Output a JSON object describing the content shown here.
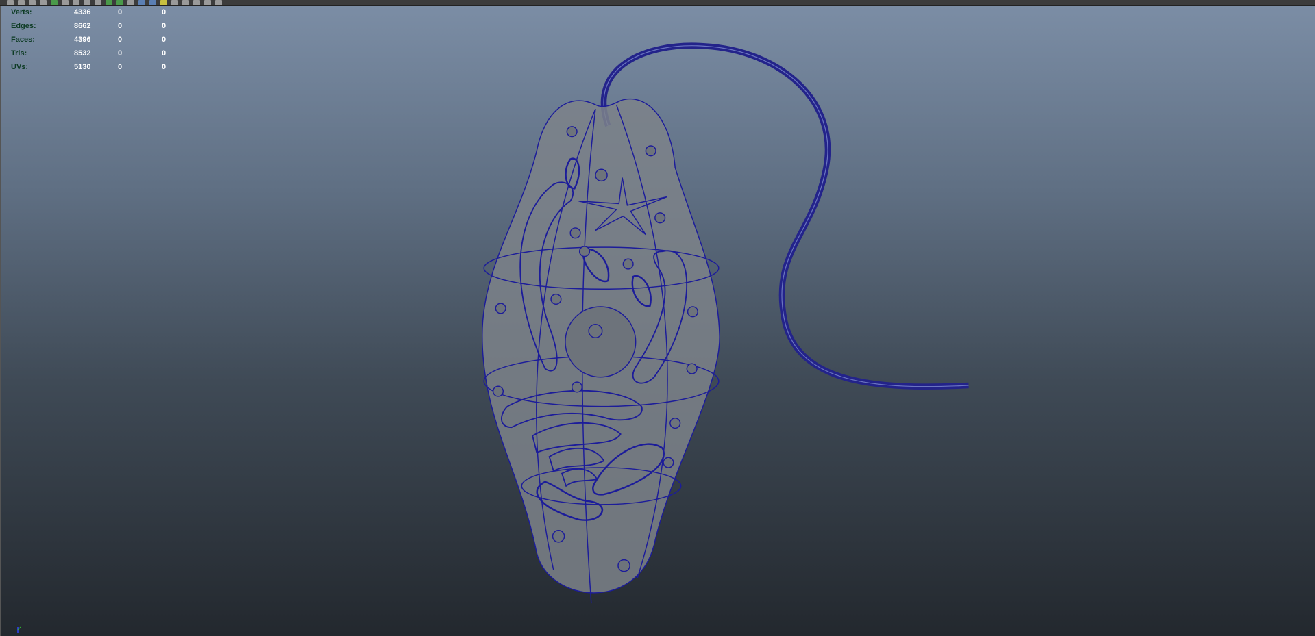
{
  "stats": {
    "rows": [
      {
        "label": "Verts:",
        "values": [
          "4336",
          "0",
          "0"
        ]
      },
      {
        "label": "Edges:",
        "values": [
          "8662",
          "0",
          "0"
        ]
      },
      {
        "label": "Faces:",
        "values": [
          "4396",
          "0",
          "0"
        ]
      },
      {
        "label": "Tris:",
        "values": [
          "8532",
          "0",
          "0"
        ]
      },
      {
        "label": "UVs:",
        "values": [
          "5130",
          "0",
          "0"
        ]
      }
    ]
  },
  "colors": {
    "wire": "#1c1c9a",
    "mesh": "#7d838a"
  }
}
